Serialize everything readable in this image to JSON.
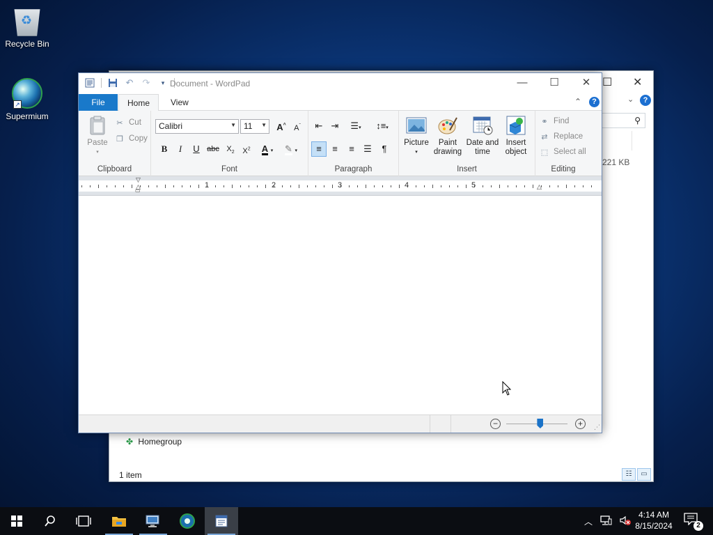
{
  "desktop": {
    "icons": [
      {
        "label": "Recycle Bin",
        "icon": "recycle-bin-icon"
      },
      {
        "label": "Supermium",
        "icon": "supermium-icon"
      }
    ]
  },
  "explorer": {
    "size_text": "221 KB",
    "homegroup_label": "Homegroup",
    "status_text": "1 item",
    "help": "?"
  },
  "wordpad": {
    "title": "Document - WordPad",
    "tabs": {
      "file": "File",
      "home": "Home",
      "view": "View"
    },
    "help": "?",
    "clipboard": {
      "paste": "Paste",
      "cut": "Cut",
      "copy": "Copy",
      "label": "Clipboard"
    },
    "font": {
      "family": "Calibri",
      "size": "11",
      "label": "Font"
    },
    "paragraph": {
      "label": "Paragraph"
    },
    "insert": {
      "picture": "Picture",
      "paint_line1": "Paint",
      "paint_line2": "drawing",
      "date_line1": "Date and",
      "date_line2": "time",
      "object_line1": "Insert",
      "object_line2": "object",
      "label": "Insert"
    },
    "editing": {
      "find": "Find",
      "replace": "Replace",
      "select_all": "Select all",
      "label": "Editing"
    },
    "ruler_numbers": [
      "1",
      "2",
      "3",
      "4",
      "5"
    ],
    "zoom": {
      "minus": "−",
      "plus": "+",
      "level": 0.55
    }
  },
  "taskbar": {
    "clock_time": "4:14 AM",
    "clock_date": "8/15/2024",
    "notification_count": "2",
    "items": [
      "start",
      "search",
      "task-view",
      "file-explorer",
      "network-app",
      "supermium",
      "wordpad"
    ]
  },
  "colors": {
    "accent": "#1979ca",
    "taskbar": "#0b0d12",
    "desktop": "#0a3270"
  }
}
